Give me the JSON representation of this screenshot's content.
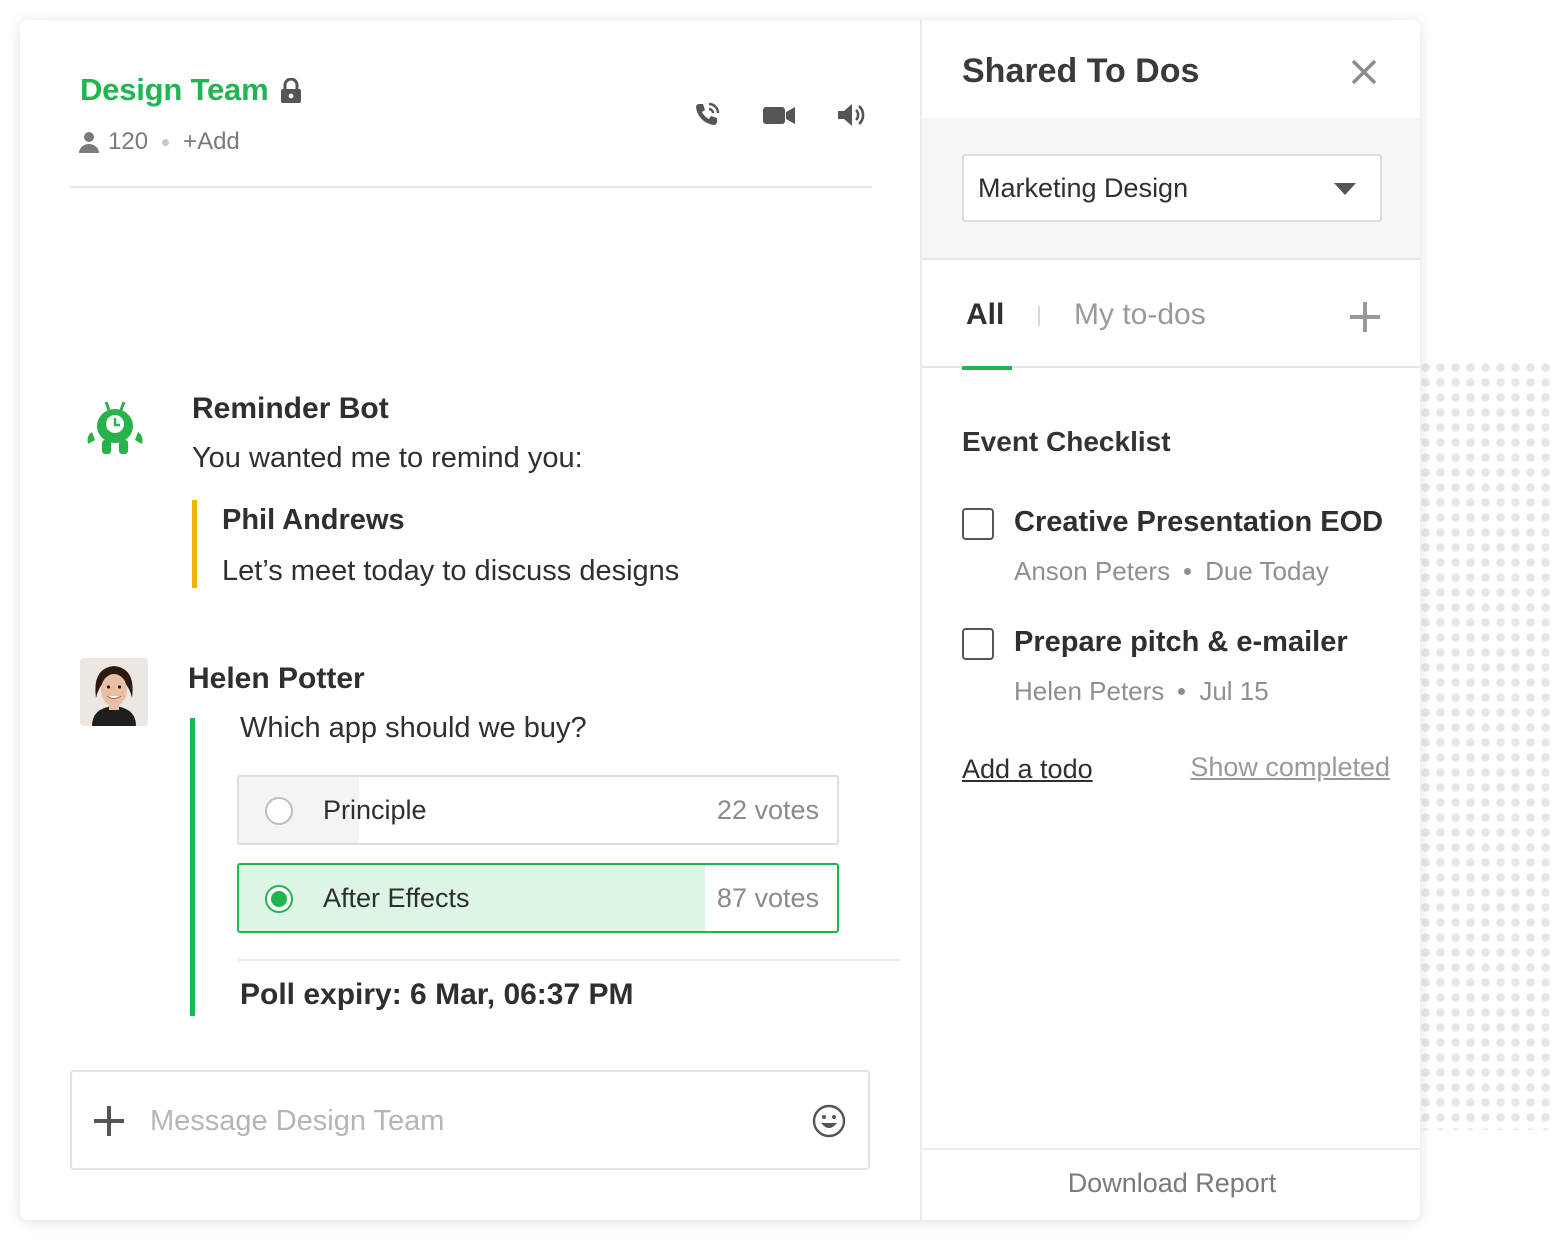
{
  "colors": {
    "accent": "#1fb550",
    "quote": "#f0b400",
    "poll_fill": "#dcf5e4"
  },
  "chat": {
    "channel": {
      "title": "Design Team",
      "lock_icon": "lock-icon",
      "member_count": "120",
      "add_label": "+Add"
    },
    "toolbar_icons": [
      "phone-call-icon",
      "video-camera-icon",
      "speaker-icon"
    ],
    "messages": [
      {
        "sender": "Reminder Bot",
        "avatar": "robot-clock-icon",
        "text": "You wanted me to remind you:",
        "quote": {
          "author": "Phil Andrews",
          "text": "Let’s meet today to discuss designs"
        }
      },
      {
        "sender": "Helen Potter",
        "avatar": "user-photo",
        "poll": {
          "question": "Which app should we buy?",
          "options": [
            {
              "label": "Principle",
              "votes": "22 votes",
              "share": 0.2,
              "selected": false
            },
            {
              "label": "After Effects",
              "votes": "87 votes",
              "share": 0.78,
              "selected": true
            }
          ],
          "expiry": "Poll expiry: 6 Mar, 06:37 PM"
        }
      }
    ],
    "composer": {
      "placeholder": "Message Design Team",
      "value": ""
    }
  },
  "todos": {
    "title": "Shared To Dos",
    "project": "Marketing Design",
    "tabs": {
      "all": "All",
      "mine": "My to-dos"
    },
    "checklist": {
      "title": "Event Checklist",
      "items": [
        {
          "name": "Creative Presentation EOD",
          "assignee": "Anson Peters",
          "due": "Due Today",
          "done": false
        },
        {
          "name": "Prepare pitch & e-mailer",
          "assignee": "Helen Peters",
          "due": "Jul 15",
          "done": false
        }
      ]
    },
    "add_todo": "Add a todo",
    "show_completed": "Show completed",
    "download": "Download Report"
  }
}
